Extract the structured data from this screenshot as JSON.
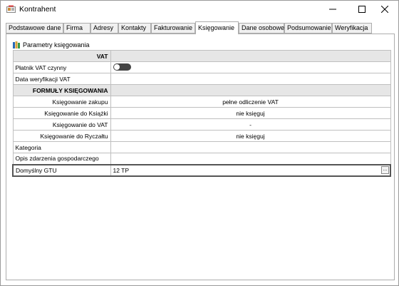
{
  "window": {
    "title": "Kontrahent",
    "controls": {
      "minimize_icon": "minimize-icon",
      "maximize_icon": "maximize-icon",
      "close_icon": "close-icon"
    }
  },
  "tabs": [
    {
      "label": "Podstawowe dane",
      "active": false
    },
    {
      "label": "Firma",
      "active": false
    },
    {
      "label": "Adresy",
      "active": false
    },
    {
      "label": "Kontakty",
      "active": false
    },
    {
      "label": "Fakturowanie",
      "active": false
    },
    {
      "label": "Księgowanie",
      "active": true
    },
    {
      "label": "Dane osobowe",
      "active": false
    },
    {
      "label": "Podsumowanie",
      "active": false
    },
    {
      "label": "Weryfikacja",
      "active": false
    }
  ],
  "section": {
    "title": "Parametry księgowania",
    "icon": "books-icon"
  },
  "grid": {
    "vat_header": "VAT",
    "platnik_vat_label": "Płatnik VAT czynny",
    "platnik_vat_value": "off",
    "data_weryfikacji_label": "Data weryfikacji VAT",
    "data_weryfikacji_value": "",
    "formuly_header": "FORMUŁY KSIĘGOWANIA",
    "ks_zakupu_label": "Księgowanie zakupu",
    "ks_zakupu_value": "pełne odliczenie VAT",
    "ks_ksiazki_label": "Księgowanie do Książki",
    "ks_ksiazki_value": "nie księguj",
    "ks_vat_label": "Księgowanie do VAT",
    "ks_vat_value": "-",
    "ks_ryczaltu_label": "Księgowanie do Ryczałtu",
    "ks_ryczaltu_value": "nie księguj",
    "kategoria_label": "Kategoria",
    "kategoria_value": "",
    "opis_label": "Opis zdarzenia gospodarczego",
    "opis_value": "",
    "gtu_label": "Domyślny GTU",
    "gtu_value": "12 TP",
    "gtu_button": "..."
  },
  "colors": {
    "header_bg": "#e6e6e6",
    "grid_line": "#bfbfbf",
    "toggle_off": "#444444"
  }
}
